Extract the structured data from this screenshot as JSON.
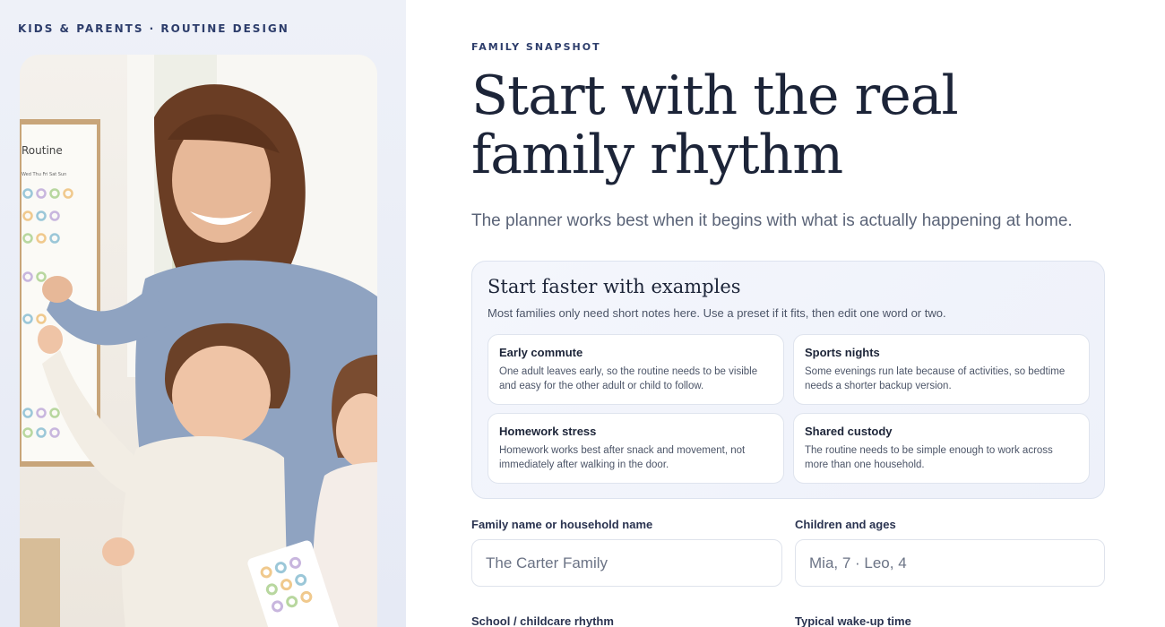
{
  "left": {
    "eyebrow": "KIDS & PARENTS · ROUTINE DESIGN",
    "chart_label": "Routine",
    "chart_days": "Wed Thu Fri Sat Sun"
  },
  "main": {
    "eyebrow": "FAMILY SNAPSHOT",
    "headline": "Start with the real family rhythm",
    "subhead": "The planner works best when it begins with what is actually happening at home."
  },
  "examples": {
    "title": "Start faster with examples",
    "description": "Most families only need short notes here. Use a preset if it fits, then edit one word or two.",
    "cards": [
      {
        "title": "Early commute",
        "desc": "One adult leaves early, so the routine needs to be visible and easy for the other adult or child to follow."
      },
      {
        "title": "Sports nights",
        "desc": "Some evenings run late because of activities, so bedtime needs a shorter backup version."
      },
      {
        "title": "Homework stress",
        "desc": "Homework works best after snack and movement, not immediately after walking in the door."
      },
      {
        "title": "Shared custody",
        "desc": "The routine needs to be simple enough to work across more than one household."
      }
    ]
  },
  "form": {
    "family_name_label": "Family name or household name",
    "family_name_placeholder": "The Carter Family",
    "children_label": "Children and ages",
    "children_placeholder": "Mia, 7 · Leo, 4",
    "school_label": "School / childcare rhythm",
    "wakeup_label": "Typical wake-up time"
  },
  "colors": {
    "accent": "#2d3d6b",
    "heading": "#1c2438",
    "panel_bg": "#eef1f8"
  }
}
